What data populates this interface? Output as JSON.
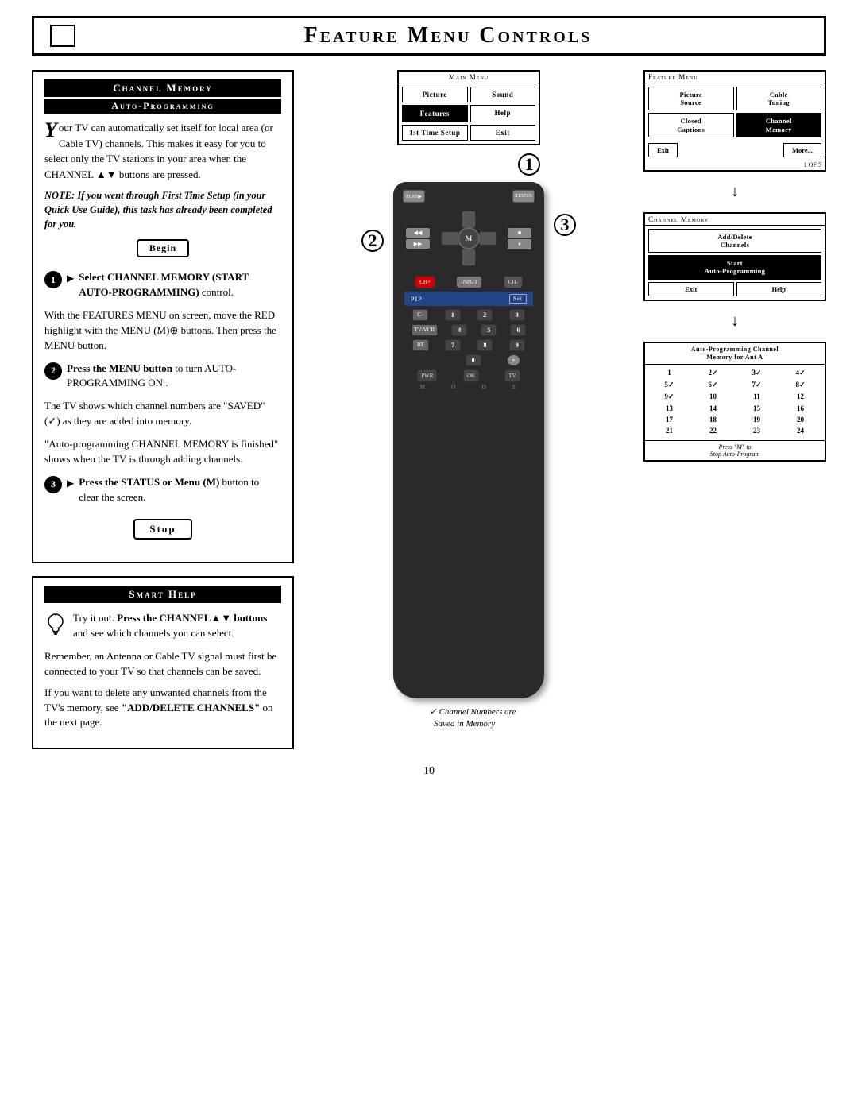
{
  "page": {
    "title": "Feature Menu Controls",
    "page_number": "10"
  },
  "left_section": {
    "channel_memory_header": "Channel Memory",
    "auto_programming_header": "Auto-Programming",
    "intro_text": "our TV can automatically set itself for local area (or Cable TV) channels. This makes it easy for you to select only the TV stations in your area when the CHANNEL ▲▼ buttons are pressed.",
    "note_text": "NOTE: If you went through First Time Setup (in your Quick Use Guide), this task has already been completed for you.",
    "begin_label": "Begin",
    "step1_label": "Select CHANNEL MEMORY (START AUTO-PROGRAMMING) control.",
    "step2_intro": "With the FEATURES MENU on screen, move the RED highlight with the MENU (M)",
    "step2_main": "buttons. Then press the MENU button.",
    "step2_numbered": "Press the MENU button to turn AUTO-PROGRAMMING ON .",
    "step3_text": "The TV shows which channel numbers are \"SAVED\" (✓) as they are added into memory.",
    "auto_prog_finish": "\"Auto-programming CHANNEL MEMORY is finished\" shows when the TV is through adding channels.",
    "step3_label": "Press the STATUS or Menu (M) button to clear the screen.",
    "stop_label": "Stop",
    "smart_help_header": "Smart Help",
    "smart_help_intro": "Try it out. Press the CHANNEL▲▼ buttons",
    "smart_help_1": "and see which channels you can select.",
    "smart_help_2": "Remember, an Antenna or Cable TV signal must first be connected to your TV so that channels can be saved.",
    "smart_help_3": "If you want to delete any unwanted channels from the TV's memory, see \"ADD/DELETE CHANNELS\" on the next page."
  },
  "main_menu": {
    "label": "Main Menu",
    "items": [
      {
        "label": "Picture",
        "highlighted": false
      },
      {
        "label": "Sound",
        "highlighted": false
      },
      {
        "label": "Features",
        "highlighted": true
      },
      {
        "label": "Help",
        "highlighted": false
      },
      {
        "label": "1st Time Setup",
        "highlighted": false
      },
      {
        "label": "Exit",
        "highlighted": false
      }
    ]
  },
  "feature_menu": {
    "label": "Feature Menu",
    "items": [
      {
        "label": "Picture\nSource",
        "highlighted": false
      },
      {
        "label": "Cable\nTuning",
        "highlighted": false
      },
      {
        "label": "Closed\nCaptions",
        "highlighted": false
      },
      {
        "label": "Channel\nMemory",
        "highlighted": true
      }
    ],
    "exit_label": "Exit",
    "more_label": "More...",
    "page_label": "1 OF 5"
  },
  "channel_memory_menu": {
    "label": "Channel Memory",
    "items": [
      {
        "label": "Add/Delete\nChannels",
        "highlighted": false
      },
      {
        "label": "Start\nAuto-Programming",
        "highlighted": true
      }
    ],
    "exit_label": "Exit",
    "help_label": "Help"
  },
  "auto_prog_table": {
    "title": "Auto-Programming Channel\nMemory for Ant A",
    "channels": [
      {
        "num": "1",
        "checked": false
      },
      {
        "num": "2",
        "checked": true
      },
      {
        "num": "3",
        "checked": true
      },
      {
        "num": "4",
        "checked": true
      },
      {
        "num": "5",
        "checked": true
      },
      {
        "num": "6",
        "checked": true
      },
      {
        "num": "7",
        "checked": true
      },
      {
        "num": "8",
        "checked": true
      },
      {
        "num": "9",
        "checked": true
      },
      {
        "num": "10",
        "checked": false
      },
      {
        "num": "11",
        "checked": false
      },
      {
        "num": "12",
        "checked": false
      },
      {
        "num": "13",
        "checked": false
      },
      {
        "num": "14",
        "checked": false
      },
      {
        "num": "15",
        "checked": false
      },
      {
        "num": "16",
        "checked": false
      },
      {
        "num": "17",
        "checked": false
      },
      {
        "num": "18",
        "checked": false
      },
      {
        "num": "19",
        "checked": false
      },
      {
        "num": "20",
        "checked": false
      },
      {
        "num": "21",
        "checked": false
      },
      {
        "num": "22",
        "checked": false
      },
      {
        "num": "23",
        "checked": false
      },
      {
        "num": "24",
        "checked": false
      }
    ],
    "press_m_note": "Press \"M\" to\nStop Auto-Program",
    "channel_note_line1": "Channel Numbers are",
    "channel_note_line2": "Saved in Memory"
  },
  "remote": {
    "play_label": "Play▶",
    "status_label": "Status",
    "m_label": "M",
    "pip_label": "PIP",
    "set_label": "Set",
    "mode_letters": "M O D E"
  }
}
